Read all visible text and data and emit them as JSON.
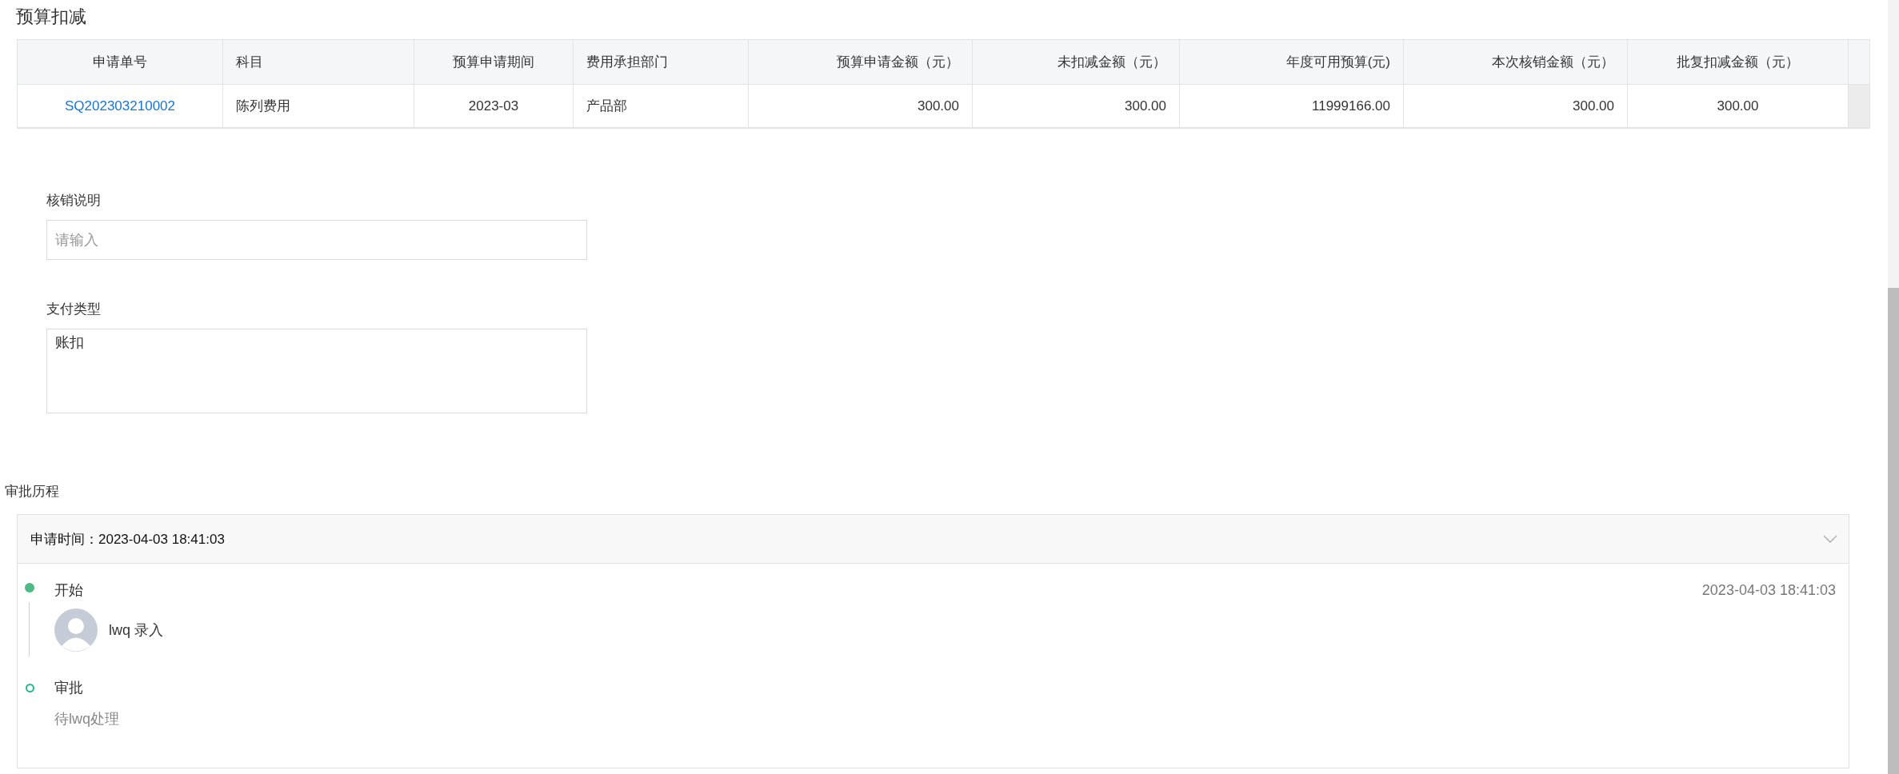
{
  "section_title": "预算扣减",
  "table": {
    "columns": [
      "申请单号",
      "科目",
      "预算申请期间",
      "费用承担部门",
      "预算申请金额（元）",
      "未扣减金额（元）",
      "年度可用预算(元)",
      "本次核销金额（元）",
      "批复扣减金额（元）"
    ],
    "rows": [
      {
        "cells": [
          {
            "text": "SQ202303210002",
            "kind": "link"
          },
          {
            "text": "陈列费用",
            "kind": "text"
          },
          {
            "text": "2023-03",
            "kind": "text"
          },
          {
            "text": "产品部",
            "kind": "text"
          },
          {
            "text": "300.00",
            "kind": "text"
          },
          {
            "text": "300.00",
            "kind": "text"
          },
          {
            "text": "11999166.00",
            "kind": "text"
          },
          {
            "text": "300.00",
            "kind": "text"
          },
          {
            "text": "300.00",
            "kind": "text"
          }
        ]
      }
    ]
  },
  "form": [
    {
      "label": "核销说明",
      "kind": "input",
      "placeholder": "请输入"
    },
    {
      "label": "支付类型",
      "kind": "textarea",
      "value": "账扣"
    }
  ],
  "approval": {
    "title": "审批历程",
    "header": "申请时间：2023-04-03 18:41:03",
    "expanded": true,
    "steps": [
      {
        "name": "开始",
        "completed": true,
        "time": "2023-04-03 18:41:03",
        "entries": [
          "lwq 录入"
        ]
      },
      {
        "name": "审批",
        "completed": false,
        "note": "待lwq处理"
      }
    ]
  }
}
